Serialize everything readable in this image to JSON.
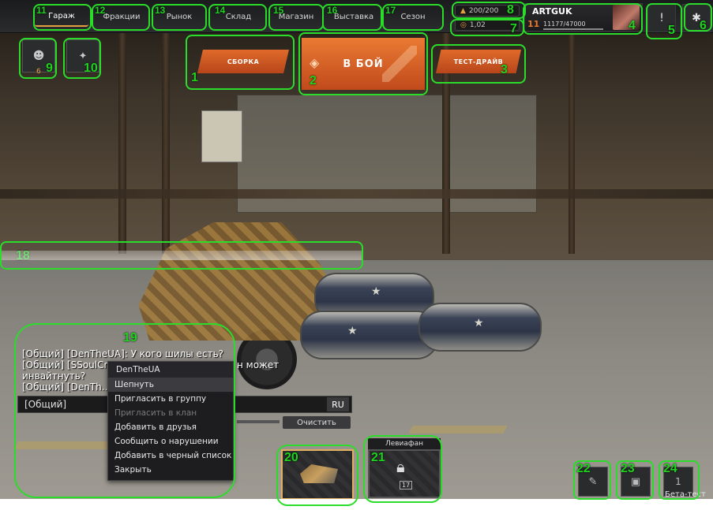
{
  "tabs": [
    {
      "label": "Гараж"
    },
    {
      "label": "Фракции"
    },
    {
      "label": "Рынок"
    },
    {
      "label": "Склад"
    },
    {
      "label": "Магазин"
    },
    {
      "label": "Выставка"
    },
    {
      "label": "Сезон"
    }
  ],
  "resources": {
    "top": "200/200",
    "bottom": "1,02"
  },
  "player": {
    "name": "ARTGUK",
    "level": "11",
    "xp": "11177/47000"
  },
  "actions": {
    "build": "СБОРКА",
    "fight": "В БОЙ",
    "test_drive": "ТЕСТ-ДРАЙВ"
  },
  "party": {
    "count": "6"
  },
  "chat": {
    "lines": [
      "[Общий] [DenTheUA]: У кого шилы есть?",
      "[Общий] [SSoulCr...",
      "н может",
      "инвайтнуть?",
      "[Общий] [DenTh..."
    ],
    "channel": "[Общий]",
    "lang": "RU",
    "clear": "Очистить"
  },
  "context_menu": {
    "title": "DenTheUA",
    "items": [
      "Шепнуть",
      "Пригласить в группу",
      "Пригласить в клан",
      "Добавить в друзья",
      "Сообщить о нарушении",
      "Добавить в черный список",
      "Закрыть"
    ]
  },
  "vehicles": {
    "locked_name": "Левиафан",
    "locked_level": "17"
  },
  "beta_label": "Бета-тест",
  "annotations": [
    "1",
    "2",
    "3",
    "4",
    "5",
    "6",
    "7",
    "8",
    "9",
    "10",
    "11",
    "12",
    "13",
    "14",
    "15",
    "16",
    "17",
    "18",
    "19",
    "20",
    "21",
    "22",
    "23",
    "24"
  ],
  "colors": {
    "annotation": "#2bdc2b",
    "accent_orange": "#e06a2a"
  }
}
